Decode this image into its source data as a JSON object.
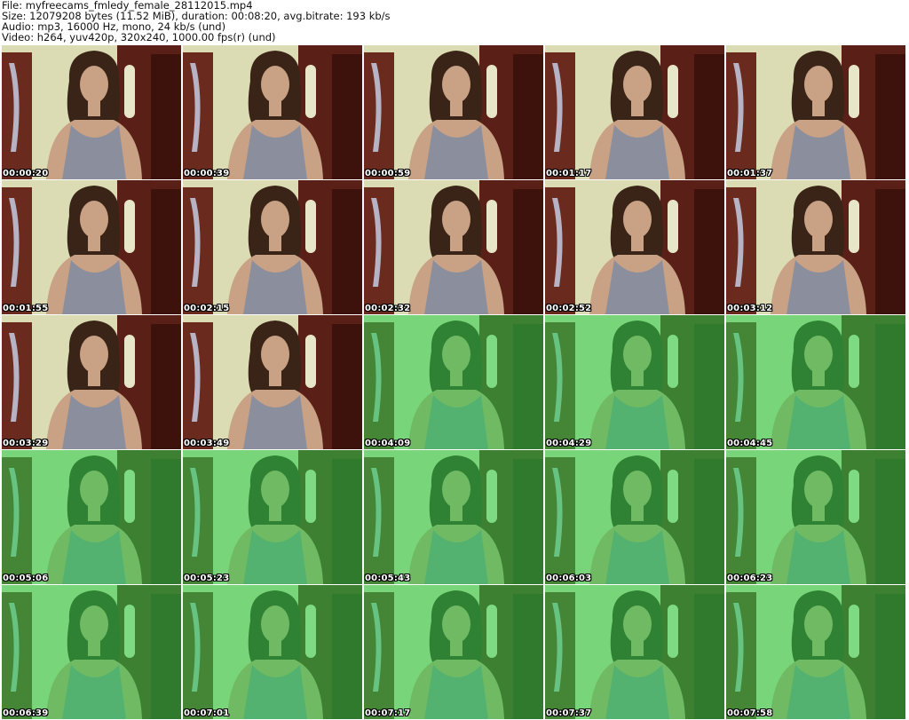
{
  "header": {
    "file_line": "File: myfreecams_fmledy_female_28112015.mp4",
    "size_line": "Size: 12079208 bytes (11.52 MiB), duration: 00:08:20, avg.bitrate: 193 kb/s",
    "audio_line": "Audio: mp3, 16000 Hz, mono, 24 kb/s (und)",
    "video_line": "Video: h264, yuv420p, 320x240, 1000.00 fps(r) (und)"
  },
  "thumbnails": [
    {
      "timestamp": "00:00:20",
      "tint": "normal"
    },
    {
      "timestamp": "00:00:39",
      "tint": "normal"
    },
    {
      "timestamp": "00:00:59",
      "tint": "normal"
    },
    {
      "timestamp": "00:01:17",
      "tint": "normal"
    },
    {
      "timestamp": "00:01:37",
      "tint": "normal"
    },
    {
      "timestamp": "00:01:55",
      "tint": "normal"
    },
    {
      "timestamp": "00:02:15",
      "tint": "normal"
    },
    {
      "timestamp": "00:02:32",
      "tint": "normal"
    },
    {
      "timestamp": "00:02:52",
      "tint": "normal"
    },
    {
      "timestamp": "00:03:12",
      "tint": "normal"
    },
    {
      "timestamp": "00:03:29",
      "tint": "normal"
    },
    {
      "timestamp": "00:03:49",
      "tint": "normal"
    },
    {
      "timestamp": "00:04:09",
      "tint": "green"
    },
    {
      "timestamp": "00:04:29",
      "tint": "green"
    },
    {
      "timestamp": "00:04:45",
      "tint": "green"
    },
    {
      "timestamp": "00:05:06",
      "tint": "green"
    },
    {
      "timestamp": "00:05:23",
      "tint": "green"
    },
    {
      "timestamp": "00:05:43",
      "tint": "green"
    },
    {
      "timestamp": "00:06:03",
      "tint": "green"
    },
    {
      "timestamp": "00:06:23",
      "tint": "green"
    },
    {
      "timestamp": "00:06:39",
      "tint": "green"
    },
    {
      "timestamp": "00:07:01",
      "tint": "green"
    },
    {
      "timestamp": "00:07:17",
      "tint": "green"
    },
    {
      "timestamp": "00:07:37",
      "tint": "green"
    },
    {
      "timestamp": "00:07:58",
      "tint": "green"
    }
  ],
  "colors": {
    "wall": "#dcdcb4",
    "door": "#5a1f16",
    "hair": "#3a2418",
    "skin": "#c9a184",
    "top": "#8b8e9c",
    "green_overlay": "#27d04a"
  }
}
